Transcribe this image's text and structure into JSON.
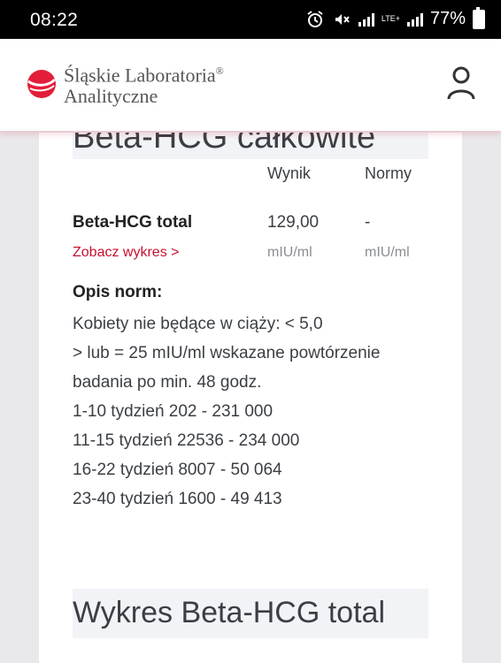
{
  "status_bar": {
    "time": "08:22",
    "battery": "77%",
    "network": "LTE+",
    "icons": [
      "alarm-icon",
      "vibrate-mute-icon",
      "signal-icon",
      "lte-signal-icon",
      "battery-icon"
    ]
  },
  "header": {
    "brand_line1": "Śląskie Laboratoria",
    "brand_line2": "Analityczne",
    "registered": "®",
    "brand_color": "#e31e3a"
  },
  "result": {
    "section_title": "Beta-HCG całkowite",
    "col_result": "Wynik",
    "col_norms": "Normy",
    "name": "Beta-HCG total",
    "value": "129,00",
    "norm_value": "-",
    "chart_link": "Zobacz wykres >",
    "unit_value": "mIU/ml",
    "unit_norm": "mIU/ml",
    "link_color": "#c8102e"
  },
  "norms": {
    "heading": "Opis norm:",
    "lines": [
      "Kobiety nie będące w ciąży: < 5,0",
      "> lub = 25 mIU/ml wskazane powtórzenie",
      "badania po min. 48 godz.",
      "1-10 tydzień 202 - 231 000",
      "11-15 tydzień 22536 - 234 000",
      "16-22 tydzień 8007 - 50 064",
      "23-40 tydzień 1600 - 49 413"
    ]
  },
  "chart_section": {
    "title": "Wykres Beta-HCG total"
  }
}
